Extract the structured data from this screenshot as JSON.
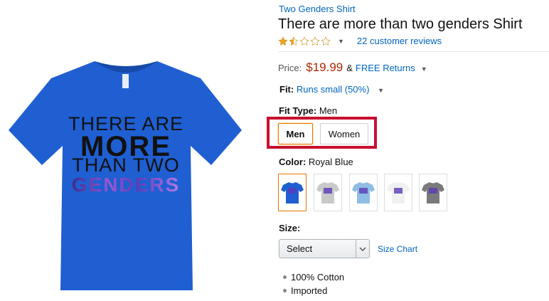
{
  "product": {
    "brand": "Two Genders Shirt",
    "title": "There are more than two genders Shirt",
    "rating_stars": 1.5,
    "review_count_label": "22 customer reviews",
    "image_text": [
      "THERE ARE",
      "MORE",
      "THAN TWO",
      "GENDERS"
    ],
    "shirt_color": "#1f5fd1"
  },
  "price": {
    "label": "Price:",
    "value": "$19.99",
    "amp": "&",
    "returns_label": "FREE Returns"
  },
  "fit": {
    "label": "Fit:",
    "value": "Runs small (50%)"
  },
  "fit_type": {
    "label": "Fit Type:",
    "value": "Men",
    "options": [
      "Men",
      "Women"
    ]
  },
  "color": {
    "label": "Color:",
    "value": "Royal Blue",
    "swatches": [
      {
        "name": "Royal Blue",
        "hex": "#1f5fd1"
      },
      {
        "name": "Silver",
        "hex": "#c9c9c9"
      },
      {
        "name": "Light Blue",
        "hex": "#8fbde3"
      },
      {
        "name": "White",
        "hex": "#f1f1f1"
      },
      {
        "name": "Grey",
        "hex": "#7a7a7a"
      }
    ]
  },
  "size": {
    "label": "Size:",
    "selected": "Select",
    "chart_link": "Size Chart"
  },
  "details": [
    "100% Cotton",
    "Imported"
  ],
  "colors": {
    "link": "#0066c0",
    "price": "#b12704",
    "highlight_box": "#c8102e",
    "selected_border": "#e77600",
    "star_fill": "#f0a31c"
  }
}
